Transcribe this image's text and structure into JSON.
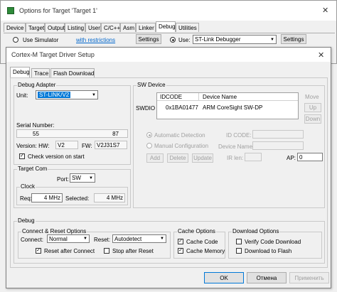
{
  "back_window": {
    "title": "Options for Target 'Target 1'",
    "close_glyph": "✕",
    "tabs": [
      "Device",
      "Target",
      "Output",
      "Listing",
      "User",
      "C/C++",
      "Asm",
      "Linker",
      "Debug",
      "Utilities"
    ],
    "active_tab": "Debug",
    "use_simulator_label": "Use Simulator",
    "with_restrictions": "with restrictions",
    "settings_label": "Settings",
    "use_label": "Use:",
    "debugger_value": "ST-Link Debugger"
  },
  "dialog": {
    "title": "Cortex-M Target Driver Setup",
    "close_glyph": "✕",
    "tabs": [
      "Debug",
      "Trace",
      "Flash Download"
    ],
    "debug_adapter": {
      "label": "Debug Adapter",
      "unit_label": "Unit:",
      "unit_value": "ST-LINK/V2",
      "serial_label": "Serial Number:",
      "serial_value_left": "55",
      "serial_value_right": "87",
      "version_label": "Version: HW:",
      "hw_value": "V2",
      "fw_label": "FW:",
      "fw_value": "V2J31S7",
      "check_version_label": "Check version on start"
    },
    "target_com": {
      "label": "Target Com",
      "port_label": "Port:",
      "port_value": "SW",
      "clock_label": "Clock",
      "req_label": "Req:",
      "req_value": "4 MHz",
      "selected_label": "Selected:",
      "selected_value": "4 MHz"
    },
    "sw_device": {
      "label": "SW Device",
      "swdio_label": "SWDIO",
      "col_idcode": "IDCODE",
      "col_device_name": "Device Name",
      "row_idcode": "0x1BA01477",
      "row_device_name": "ARM CoreSight SW-DP",
      "move_label": "Move",
      "up_label": "Up",
      "down_label": "Down",
      "auto_detection_label": "Automatic Detection",
      "manual_config_label": "Manual Configuration",
      "id_code_label": "ID CODE:",
      "device_name_label": "Device Name:",
      "add_label": "Add",
      "delete_label": "Delete",
      "update_label": "Update",
      "ir_len_label": "IR len:",
      "ap_label": "AP:",
      "ap_value": "0"
    },
    "debug_group": {
      "label": "Debug",
      "connect_reset": {
        "label": "Connect & Reset Options",
        "connect_label": "Connect:",
        "connect_value": "Normal",
        "reset_label": "Reset:",
        "reset_value": "Autodetect",
        "reset_after_connect_label": "Reset after Connect",
        "stop_after_reset_label": "Stop after Reset"
      },
      "cache": {
        "label": "Cache Options",
        "cache_code_label": "Cache Code",
        "cache_memory_label": "Cache Memory"
      },
      "download": {
        "label": "Download Options",
        "verify_label": "Verify Code Download",
        "download_flash_label": "Download to Flash"
      }
    },
    "footer": {
      "ok_label": "OK",
      "cancel_label": "Отмена",
      "apply_label": "Применить"
    }
  },
  "check_glyph": "✓",
  "arrow_glyph": "▼",
  "colors": {
    "selected_blue": "#0078d7",
    "link_blue": "#0066cc",
    "disabled_gray": "#a0a0a0"
  }
}
